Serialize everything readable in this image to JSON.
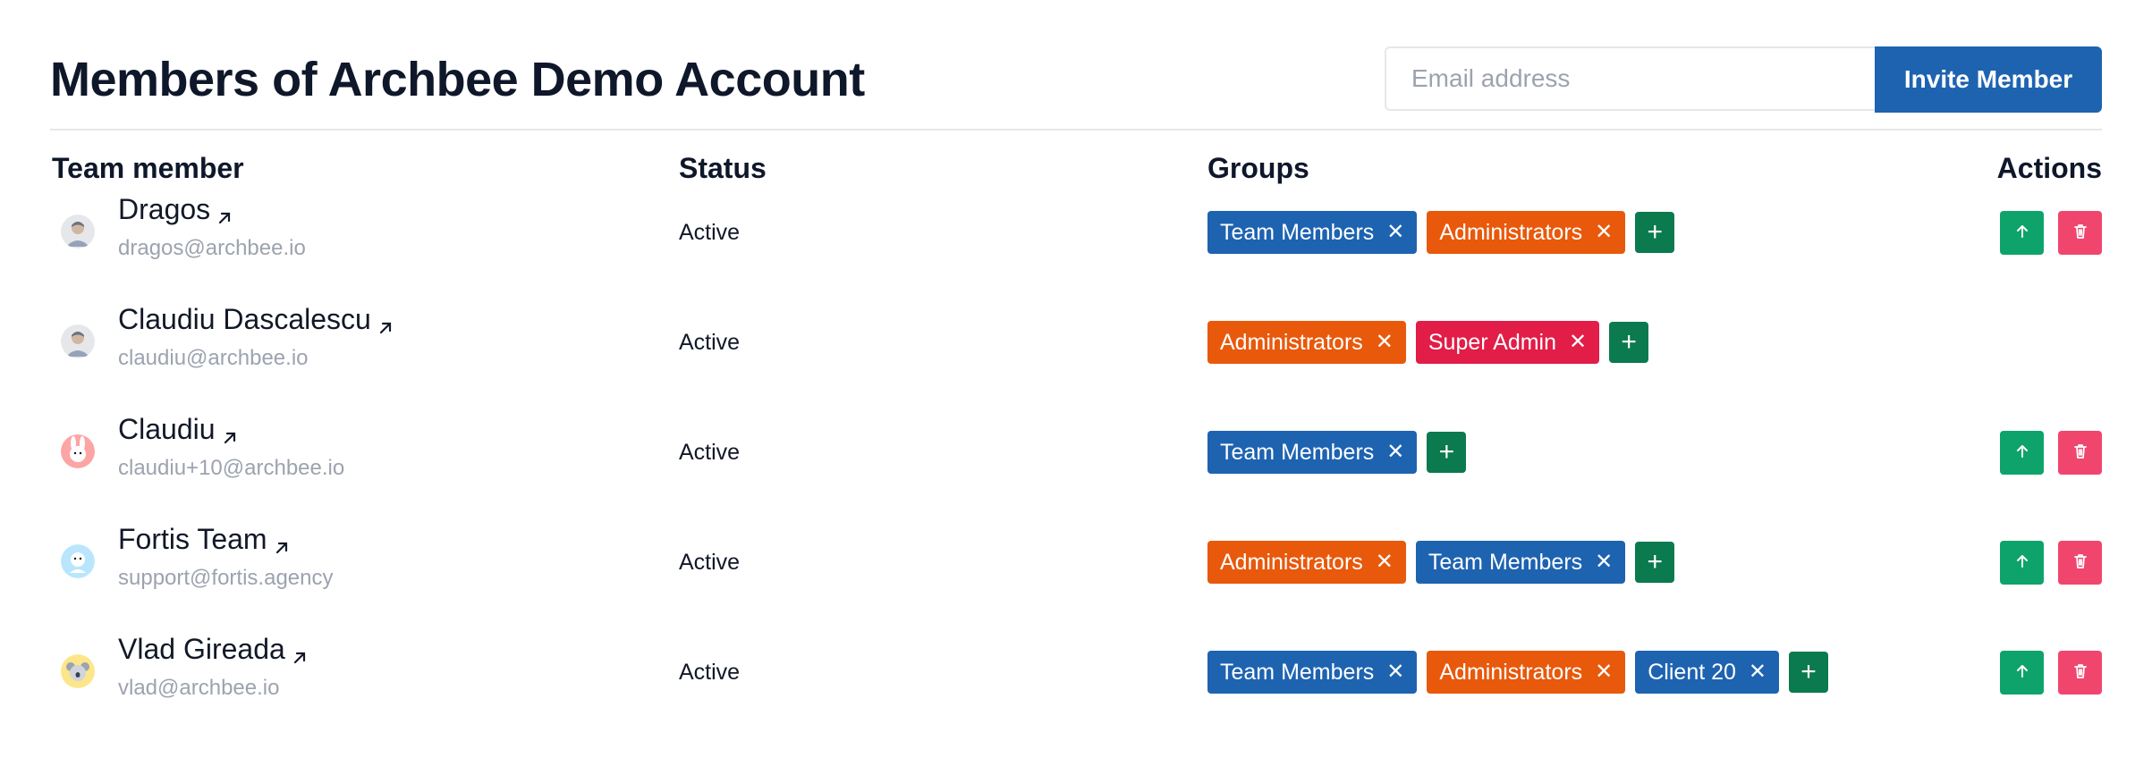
{
  "header": {
    "title": "Members of Archbee Demo Account",
    "email_placeholder": "Email address",
    "invite_label": "Invite Member"
  },
  "columns": {
    "member": "Team member",
    "status": "Status",
    "groups": "Groups",
    "actions": "Actions"
  },
  "members": [
    {
      "name": "Dragos",
      "email": "dragos@archbee.io",
      "status": "Active",
      "avatar": "avatar-man-icon",
      "groups": [
        "Team Members",
        "Administrators"
      ],
      "add_label": "+",
      "has_actions": true
    },
    {
      "name": "Claudiu Dascalescu",
      "email": "claudiu@archbee.io",
      "status": "Active",
      "avatar": "avatar-man-icon",
      "groups": [
        "Administrators",
        "Super Admin"
      ],
      "add_label": "+",
      "has_actions": false
    },
    {
      "name": "Claudiu",
      "email": "claudiu+10@archbee.io",
      "status": "Active",
      "avatar": "avatar-bunny-icon",
      "groups": [
        "Team Members"
      ],
      "add_label": "+",
      "has_actions": true
    },
    {
      "name": "Fortis Team",
      "email": "support@fortis.agency",
      "status": "Active",
      "avatar": "avatar-cartoon-icon",
      "groups": [
        "Administrators",
        "Team Members"
      ],
      "add_label": "+",
      "has_actions": true
    },
    {
      "name": "Vlad Gireada",
      "email": "vlad@archbee.io",
      "status": "Active",
      "avatar": "avatar-koala-icon",
      "groups": [
        "Team Members",
        "Administrators",
        "Client 20"
      ],
      "add_label": "+",
      "has_actions": true
    }
  ],
  "group_colors": {
    "Team Members": "#1e63b0",
    "Administrators": "#e8590c",
    "Super Admin": "#e11d48",
    "Client 20": "#1e63b0"
  },
  "colors": {
    "primary": "#1e63b0",
    "add": "#0b7a4f",
    "promote": "#0ea36b",
    "delete": "#f0466d"
  }
}
